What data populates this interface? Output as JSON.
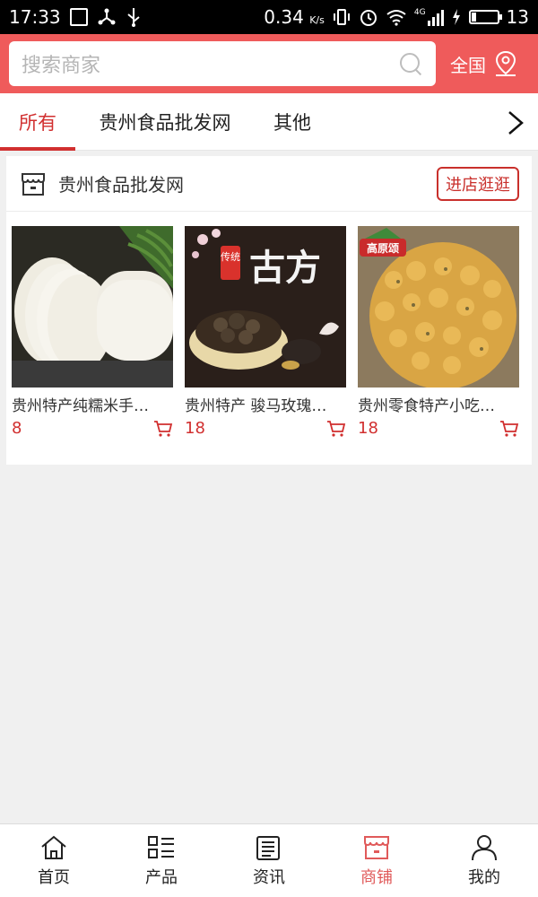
{
  "status_bar": {
    "time": "17:33",
    "speed": "0.34",
    "speed_unit": "K/s",
    "network": "4G",
    "battery": "13"
  },
  "search": {
    "placeholder": "搜索商家",
    "region_label": "全国"
  },
  "tabs": [
    {
      "label": "所有",
      "active": true
    },
    {
      "label": "贵州食品批发网",
      "active": false
    },
    {
      "label": "其他",
      "active": false
    }
  ],
  "store": {
    "name": "贵州食品批发网",
    "enter_label": "进店逛逛",
    "products": [
      {
        "title": "贵州特产纯糯米手…",
        "price": "8"
      },
      {
        "title": "贵州特产 骏马玫瑰…",
        "price": "18",
        "image_text": [
          "传统",
          "古方"
        ]
      },
      {
        "title": "贵州零食特产小吃…",
        "price": "18",
        "image_text": [
          "高原颂"
        ]
      }
    ]
  },
  "bottom_nav": [
    {
      "label": "首页",
      "icon": "home-icon",
      "active": false
    },
    {
      "label": "产品",
      "icon": "list-icon",
      "active": false
    },
    {
      "label": "资讯",
      "icon": "news-icon",
      "active": false
    },
    {
      "label": "商铺",
      "icon": "store-icon",
      "active": true
    },
    {
      "label": "我的",
      "icon": "user-icon",
      "active": false
    }
  ],
  "colors": {
    "brand": "#ef5b5b",
    "accent": "#d12f2f",
    "nav_active": "#e05a5a"
  }
}
